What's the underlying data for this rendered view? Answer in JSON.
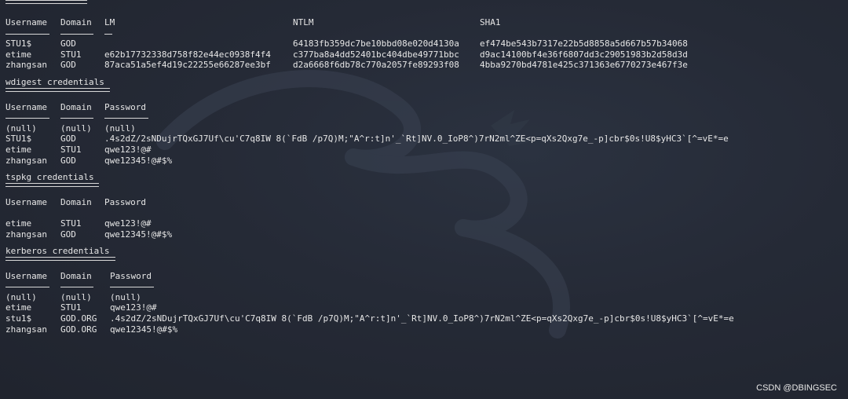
{
  "table1": {
    "headers": [
      "Username",
      "Domain",
      "LM",
      "NTLM",
      "SHA1"
    ],
    "rows": [
      [
        "STU1$",
        "GOD",
        "",
        "64183fb359dc7be10bbd08e020d4130a",
        "ef474be543b7317e22b5d8858a5d667b57b34068"
      ],
      [
        "etime",
        "STU1",
        "e62b17732338d758f82e44ec0938f4f4",
        "c377ba8a4dd52401bc404dbe49771bbc",
        "d9ac14100bf4e36f6807dd3c29051983b2d58d3d"
      ],
      [
        "zhangsan",
        "GOD",
        "87aca51a5ef4d19c22255e66287ee3bf",
        "d2a6668f6db78c770a2057fe89293f08",
        "4bba9270bd4781e425c371363e6770273e467f3e"
      ]
    ]
  },
  "wdigest": {
    "title": "wdigest credentials",
    "headers": [
      "Username",
      "Domain",
      "Password"
    ],
    "rows": [
      [
        "(null)",
        "(null)",
        "(null)"
      ],
      [
        "STU1$",
        "GOD",
        ".4s2dZ/2sNDujrTQxGJ7Uf\\cu'C7q8IW 8(`FdB /p7Q)M;\"A^r:t]n'_`Rt]NV.0_IoP8^)7rN2ml^ZE<p=qXs2Qxg7e_-p]cbr$0s!U8$yHC3`[^=vE*=e"
      ],
      [
        "etime",
        "STU1",
        "qwe123!@#"
      ],
      [
        "zhangsan",
        "GOD",
        "qwe12345!@#$%"
      ]
    ]
  },
  "tspkg": {
    "title": "tspkg credentials",
    "headers": [
      "Username",
      "Domain",
      "Password"
    ],
    "rows": [
      [
        "etime",
        "STU1",
        "qwe123!@#"
      ],
      [
        "zhangsan",
        "GOD",
        "qwe12345!@#$%"
      ]
    ]
  },
  "kerberos": {
    "title": "kerberos credentials",
    "headers": [
      "Username",
      "Domain",
      "Password"
    ],
    "rows": [
      [
        "(null)",
        "(null)",
        "(null)"
      ],
      [
        "etime",
        "STU1",
        "qwe123!@#"
      ],
      [
        "stu1$",
        "GOD.ORG",
        ".4s2dZ/2sNDujrTQxGJ7Uf\\cu'C7q8IW 8(`FdB /p7Q)M;\"A^r:t]n'_`Rt]NV.0_IoP8^)7rN2ml^ZE<p=qXs2Qxg7e_-p]cbr$0s!U8$yHC3`[^=vE*=e"
      ],
      [
        "zhangsan",
        "GOD.ORG",
        "qwe12345!@#$%"
      ]
    ]
  },
  "watermark": "CSDN @DBINGSEC",
  "icons": {
    "background": "kali-dragon-icon"
  }
}
